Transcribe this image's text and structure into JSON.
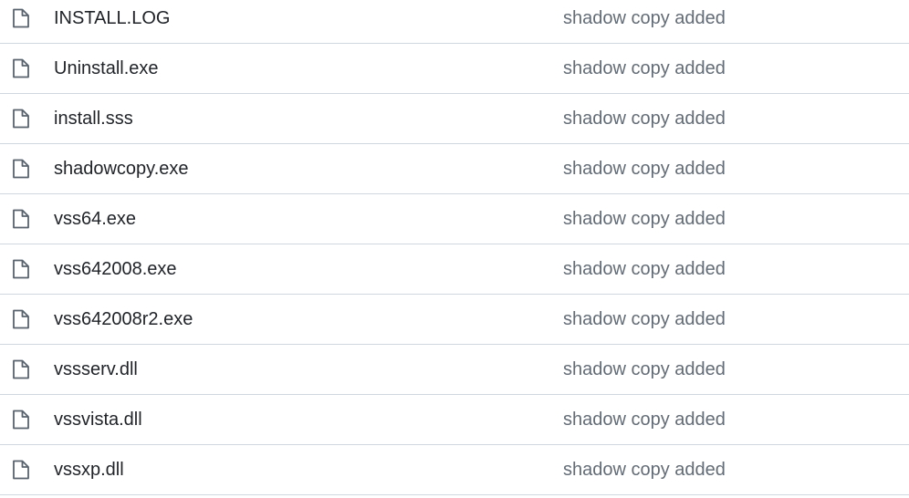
{
  "files": [
    {
      "name": "INSTALL.LOG",
      "commit_message": "shadow copy added",
      "icon": "file-icon"
    },
    {
      "name": "Uninstall.exe",
      "commit_message": "shadow copy added",
      "icon": "file-icon"
    },
    {
      "name": "install.sss",
      "commit_message": "shadow copy added",
      "icon": "file-icon"
    },
    {
      "name": "shadowcopy.exe",
      "commit_message": "shadow copy added",
      "icon": "file-icon"
    },
    {
      "name": "vss64.exe",
      "commit_message": "shadow copy added",
      "icon": "file-icon"
    },
    {
      "name": "vss642008.exe",
      "commit_message": "shadow copy added",
      "icon": "file-icon"
    },
    {
      "name": "vss642008r2.exe",
      "commit_message": "shadow copy added",
      "icon": "file-icon"
    },
    {
      "name": "vssserv.dll",
      "commit_message": "shadow copy added",
      "icon": "file-icon"
    },
    {
      "name": "vssvista.dll",
      "commit_message": "shadow copy added",
      "icon": "file-icon"
    },
    {
      "name": "vssxp.dll",
      "commit_message": "shadow copy added",
      "icon": "file-icon"
    }
  ],
  "colors": {
    "text_primary": "#1f2328",
    "text_secondary": "#636c76",
    "divider": "#d0d7de",
    "icon": "#59636e"
  }
}
